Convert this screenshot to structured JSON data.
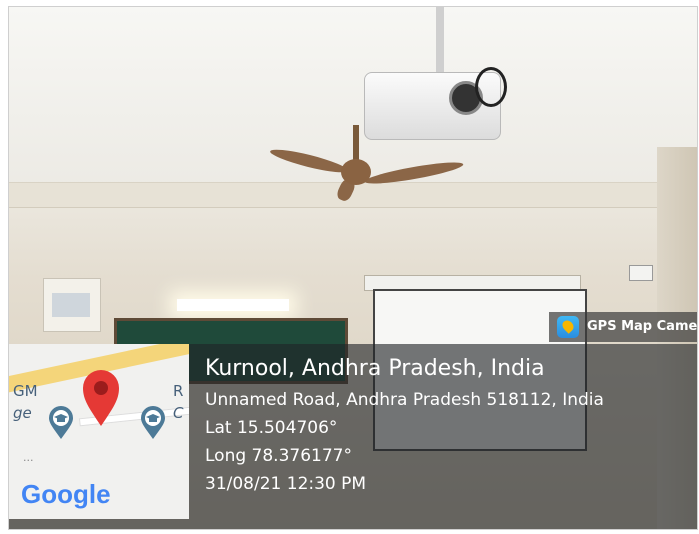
{
  "app": {
    "name": "GPS Map Camera",
    "icon": "gps-map-camera-icon"
  },
  "location": {
    "title": "Kurnool, Andhra Pradesh, India",
    "address": "Unnamed Road, Andhra Pradesh 518112, India",
    "lat": "Lat 15.504706°",
    "long": "Long 78.376177°",
    "timestamp": "31/08/21 12:30 PM"
  },
  "map": {
    "label_left_1": "GM",
    "label_left_2": "ge",
    "label_right_1": "R",
    "label_right_2": "C",
    "brand": "Google",
    "pin_icon": "location-pin-icon",
    "school_icon": "school-pin-icon"
  },
  "colors": {
    "pin": "#e53935",
    "school_pin": "#4d7a97",
    "overlay": "#202426",
    "road": "#f4d57a"
  }
}
